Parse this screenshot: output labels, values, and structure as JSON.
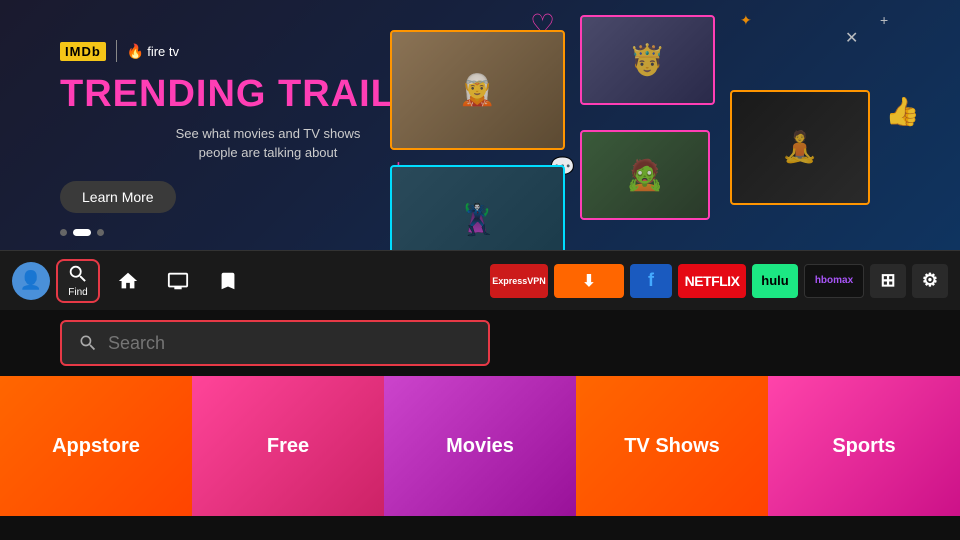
{
  "hero": {
    "imdb_label": "IMDb",
    "firetv_label": "fire tv",
    "title": "TRENDING TRAILERS",
    "subtitle": "See what movies and TV shows\npeople are talking about",
    "learn_more": "Learn More"
  },
  "nav": {
    "find_label": "Find",
    "apps": [
      {
        "id": "expressvpn",
        "label": "ExpressVPN",
        "css_class": "app-vpn"
      },
      {
        "id": "downloader",
        "label": "⬇",
        "css_class": "app-downloader"
      },
      {
        "id": "blue-app",
        "label": "f",
        "css_class": "app-blue"
      },
      {
        "id": "netflix",
        "label": "NETFLIX",
        "css_class": "app-netflix"
      },
      {
        "id": "hulu",
        "label": "hulu",
        "css_class": "app-hulu"
      },
      {
        "id": "hbomax",
        "label": "hbomax",
        "css_class": "app-hbo"
      }
    ]
  },
  "search": {
    "placeholder": "Search"
  },
  "categories": [
    {
      "id": "appstore",
      "label": "Appstore",
      "css": "cat-appstore"
    },
    {
      "id": "free",
      "label": "Free",
      "css": "cat-free"
    },
    {
      "id": "movies",
      "label": "Movies",
      "css": "cat-movies"
    },
    {
      "id": "tvshows",
      "label": "TV Shows",
      "css": "cat-tvshows"
    },
    {
      "id": "sports",
      "label": "Sports",
      "css": "cat-sports"
    }
  ],
  "dots": [
    1,
    2,
    3
  ],
  "active_dot": 1
}
